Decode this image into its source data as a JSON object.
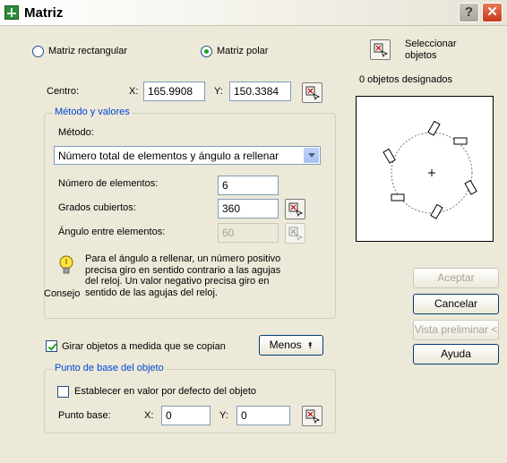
{
  "window": {
    "title": "Matriz"
  },
  "array_type": {
    "rectangular_label": "Matriz rectangular",
    "polar_label": "Matriz polar",
    "selected": "polar"
  },
  "select_objects": {
    "label_line1": "Seleccionar",
    "label_line2": "objetos",
    "count_text": "0 objetos designados"
  },
  "center": {
    "label": "Centro:",
    "x_label": "X:",
    "x_value": "165.9908",
    "y_label": "Y:",
    "y_value": "150.3384"
  },
  "method_group": {
    "title": "Método y valores",
    "method_label": "Método:",
    "method_value": "Número total de elementos y ángulo a rellenar",
    "num_items_label": "Número de elementos:",
    "num_items_value": "6",
    "angle_fill_label": "Grados cubiertos:",
    "angle_fill_value": "360",
    "angle_between_label": "Ángulo entre elementos:",
    "angle_between_value": "60"
  },
  "tip": {
    "label": "Consejo",
    "text_lines": [
      "Para el ángulo a rellenar, un número positivo",
      "precisa giro en sentido contrario a las agujas",
      "del reloj. Un valor negativo precisa giro en",
      "sentido de las agujas del reloj."
    ]
  },
  "rotate": {
    "label": "Girar objetos a medida que se copian",
    "checked": true
  },
  "less_button": {
    "label": "Menos",
    "symbol": "⯭"
  },
  "base_point_group": {
    "title": "Punto de base del objeto",
    "default_label": "Establecer en valor por defecto del objeto",
    "default_checked": false,
    "base_point_label": "Punto base:",
    "x_label": "X:",
    "x_value": "0",
    "y_label": "Y:",
    "y_value": "0"
  },
  "buttons": {
    "ok": "Aceptar",
    "cancel": "Cancelar",
    "preview": "Vista preliminar <",
    "help": "Ayuda"
  },
  "titlebar_buttons": {
    "help": "?",
    "close": "✕"
  },
  "icons": {
    "app": "array-app-icon",
    "pick": "pick-point-icon",
    "select": "select-objects-icon",
    "tip": "lightbulb-icon"
  }
}
